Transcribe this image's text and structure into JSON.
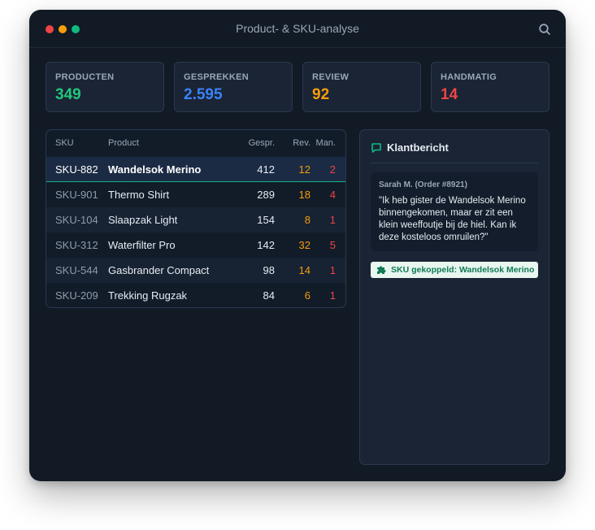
{
  "window": {
    "title": "Product- & SKU-analyse"
  },
  "stats": [
    {
      "label": "PRODUCTEN",
      "value": "349",
      "color": "#22c77d"
    },
    {
      "label": "GESPREKKEN",
      "value": "2.595",
      "color": "#3b82f6"
    },
    {
      "label": "REVIEW",
      "value": "92",
      "color": "#f59e0b"
    },
    {
      "label": "HANDMATIG",
      "value": "14",
      "color": "#ef4444"
    }
  ],
  "table": {
    "headers": {
      "sku": "SKU",
      "product": "Product",
      "gespr": "Gespr.",
      "rev": "Rev.",
      "man": "Man."
    },
    "rows": [
      {
        "sku": "SKU-882",
        "product": "Wandelsok Merino",
        "gespr": "412",
        "rev": "12",
        "man": "2",
        "selected": true
      },
      {
        "sku": "SKU-901",
        "product": "Thermo Shirt",
        "gespr": "289",
        "rev": "18",
        "man": "4"
      },
      {
        "sku": "SKU-104",
        "product": "Slaapzak Light",
        "gespr": "154",
        "rev": "8",
        "man": "1"
      },
      {
        "sku": "SKU-312",
        "product": "Waterfilter Pro",
        "gespr": "142",
        "rev": "32",
        "man": "5"
      },
      {
        "sku": "SKU-544",
        "product": "Gasbrander Compact",
        "gespr": "98",
        "rev": "14",
        "man": "1"
      },
      {
        "sku": "SKU-209",
        "product": "Trekking Rugzak",
        "gespr": "84",
        "rev": "6",
        "man": "1"
      }
    ]
  },
  "panel": {
    "title": "Klantbericht",
    "message": {
      "author": "Sarah M. (Order #8921)",
      "text": "\"Ik heb gister de Wandelsok Merino binnengekomen, maar er zit een klein weeffoutje bij de hiel. Kan ik deze kosteloos omruilen?\""
    },
    "badge": "SKU gekoppeld: Wandelsok Merino"
  },
  "colors": {
    "accent": "#10b981",
    "background": "#111a25",
    "card": "#1a2435"
  }
}
